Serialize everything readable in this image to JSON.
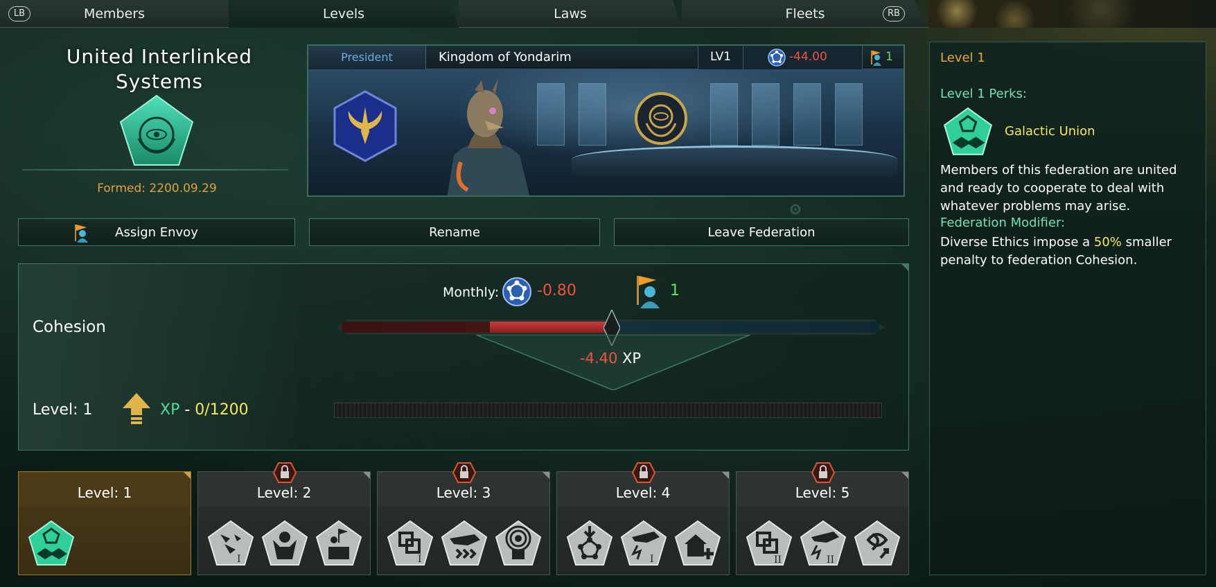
{
  "tabs": {
    "lb": "LB",
    "rb": "RB",
    "items": [
      {
        "label": "Members",
        "active": false
      },
      {
        "label": "Levels",
        "active": true
      },
      {
        "label": "Laws",
        "active": false
      },
      {
        "label": "Fleets",
        "active": false
      }
    ]
  },
  "federation": {
    "name_line1": "United Interlinked",
    "name_line2": "Systems",
    "emblem_icon": "federation-emblem-icon",
    "formed": "Formed: 2200.09.29"
  },
  "president": {
    "title": "President",
    "empire": "Kingdom of Yondarim",
    "level": "LV1",
    "cohesion_cost": "-44.00",
    "envoys": "1"
  },
  "actions": {
    "assign_envoy": "Assign Envoy",
    "rename": "Rename",
    "leave": "Leave Federation"
  },
  "cohesion": {
    "label": "Cohesion",
    "monthly_label": "Monthly:",
    "monthly_value": "-0.80",
    "monthly_envoys": "1",
    "cohesion_fill_fraction": 0.22,
    "xp_change": "-4.40",
    "xp_unit": "XP"
  },
  "level": {
    "label": "Level: 1",
    "xp_label": "XP",
    "xp_sep": " - ",
    "xp_value": "0/1200",
    "xp_progress": 0
  },
  "level_cards": [
    {
      "title": "Level: 1",
      "locked": false,
      "perks": [
        "galactic-union-icon"
      ]
    },
    {
      "title": "Level: 2",
      "locked": true,
      "perks": [
        "fleet-i-icon",
        "person-icon",
        "podium-icon"
      ]
    },
    {
      "title": "Level: 3",
      "locked": true,
      "perks": [
        "link-i-icon",
        "ship-speed-icon",
        "broadcast-icon"
      ]
    },
    {
      "title": "Level: 4",
      "locked": true,
      "perks": [
        "network-down-icon",
        "ship-strike-i-icon",
        "house-plus-icon"
      ]
    },
    {
      "title": "Level: 5",
      "locked": true,
      "perks": [
        "link-ii-icon",
        "ship-strike-ii-icon",
        "knot-growth-icon"
      ]
    }
  ],
  "side_panel": {
    "level": "Level 1",
    "perks_title": "Level 1 Perks:",
    "perk_name": "Galactic Union",
    "description": "Members of this federation are united and ready to cooperate to deal with whatever problems may arise.",
    "modifier_title": "Federation Modifier:",
    "modifier_pre": "Diverse Ethics impose a ",
    "modifier_highlight": "50%",
    "modifier_post": " smaller penalty to federation Cohesion."
  },
  "colors": {
    "negative": "#f0533f",
    "positive": "#5fe06b",
    "accent_green": "#6fe3b2",
    "accent_yellow": "#f2ea5a",
    "accent_orange": "#e8a638"
  }
}
